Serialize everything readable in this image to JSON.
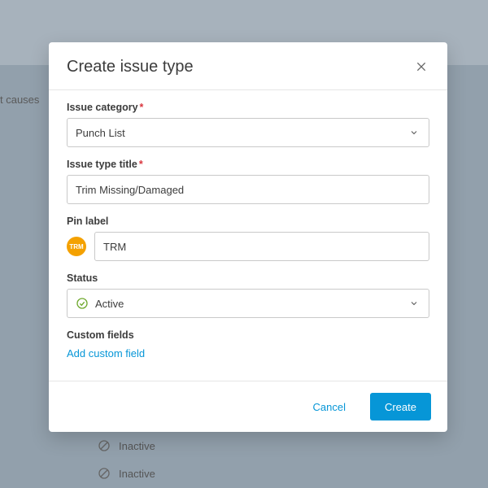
{
  "background": {
    "side_label": "t causes",
    "inactive_label": "Inactive"
  },
  "modal": {
    "title": "Create issue type",
    "fields": {
      "category_label": "Issue category",
      "category_value": "Punch List",
      "title_label": "Issue type title",
      "title_value": "Trim Missing/Damaged",
      "pin_label": "Pin label",
      "pin_chip": "TRM",
      "pin_value": "TRM",
      "status_label": "Status",
      "status_value": "Active",
      "custom_fields_label": "Custom fields",
      "add_custom_link": "Add custom field"
    },
    "footer": {
      "cancel": "Cancel",
      "create": "Create"
    }
  }
}
